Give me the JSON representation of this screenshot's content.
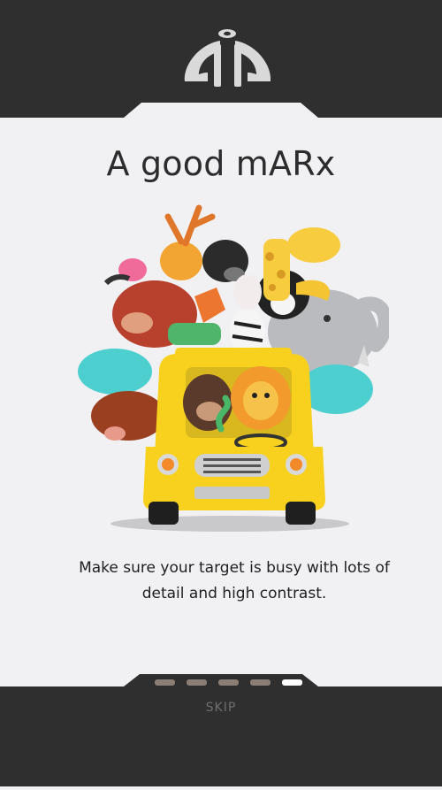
{
  "header": {
    "logo_icon": "app-logo-icon",
    "background": "#2f2f2f"
  },
  "main": {
    "title": "A good mARx",
    "illustration_icon": "animals-in-car-illustration",
    "description": "Make sure your target is busy with lots of detail and high contrast."
  },
  "footer": {
    "pagination": {
      "total": 5,
      "active_index": 4
    },
    "skip_label": "SKIP",
    "background": "#2f2f2f"
  },
  "colors": {
    "accent": "#ffffff",
    "page_bg": "#f1f1f4",
    "dot_inactive": "#8b7e74"
  }
}
